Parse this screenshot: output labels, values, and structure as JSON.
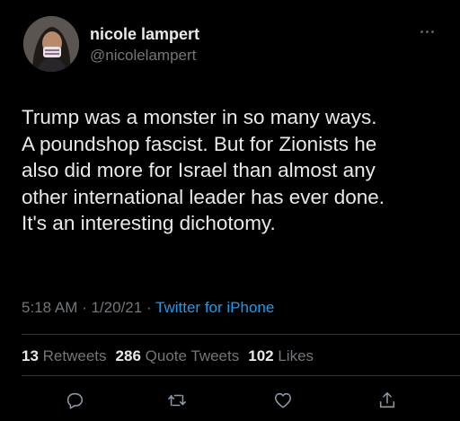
{
  "user": {
    "display_name": "nicole lampert",
    "handle": "@nicolelampert",
    "avatar_icon": "profile-photo"
  },
  "tweet": {
    "lines": [
      "Trump was a monster in so many ways.",
      "A poundshop fascist. But for Zionists he",
      "also did more for Israel than almost any",
      "other international leader has ever done.",
      "It's an interesting dichotomy."
    ],
    "time": "5:18 AM",
    "date": "1/20/21",
    "separator": " · ",
    "source": "Twitter for iPhone"
  },
  "stats": {
    "retweets_count": "13",
    "retweets_label": "Retweets",
    "quote_count": "286",
    "quote_label": "Quote Tweets",
    "likes_count": "102",
    "likes_label": "Likes"
  },
  "actions": [
    {
      "icon": "reply-icon"
    },
    {
      "icon": "retweet-icon"
    },
    {
      "icon": "like-icon"
    },
    {
      "icon": "share-icon"
    }
  ],
  "colors": {
    "background": "#000000",
    "text": "#e7e9ea",
    "secondary": "#71767b",
    "accent": "#1d9bf0",
    "divider": "#2f3336"
  }
}
